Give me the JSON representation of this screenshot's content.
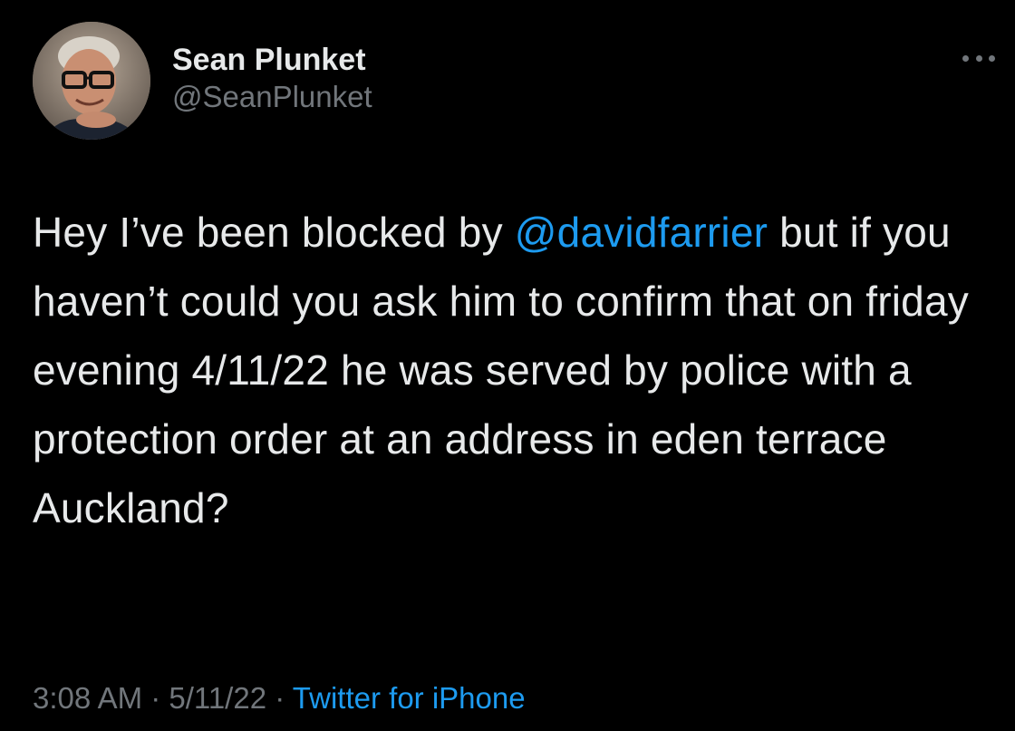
{
  "user": {
    "display_name": "Sean Plunket",
    "handle": "@SeanPlunket"
  },
  "tweet": {
    "part1": "Hey I’ve been blocked by ",
    "mention": "@davidfarrier",
    "part2": " but if you haven’t could you ask him to confirm that on friday evening 4/11/22 he was served by police with a protection order at an address in eden terrace Auckland?"
  },
  "meta": {
    "time": "3:08 AM",
    "separator": " · ",
    "date": "5/11/22",
    "source": "Twitter for iPhone"
  },
  "icons": {
    "more": "more-horizontal-icon",
    "avatar": "avatar-photo"
  },
  "colors": {
    "background": "#000000",
    "text": "#e7e9ea",
    "secondary": "#71767b",
    "link": "#1d9bf0"
  }
}
